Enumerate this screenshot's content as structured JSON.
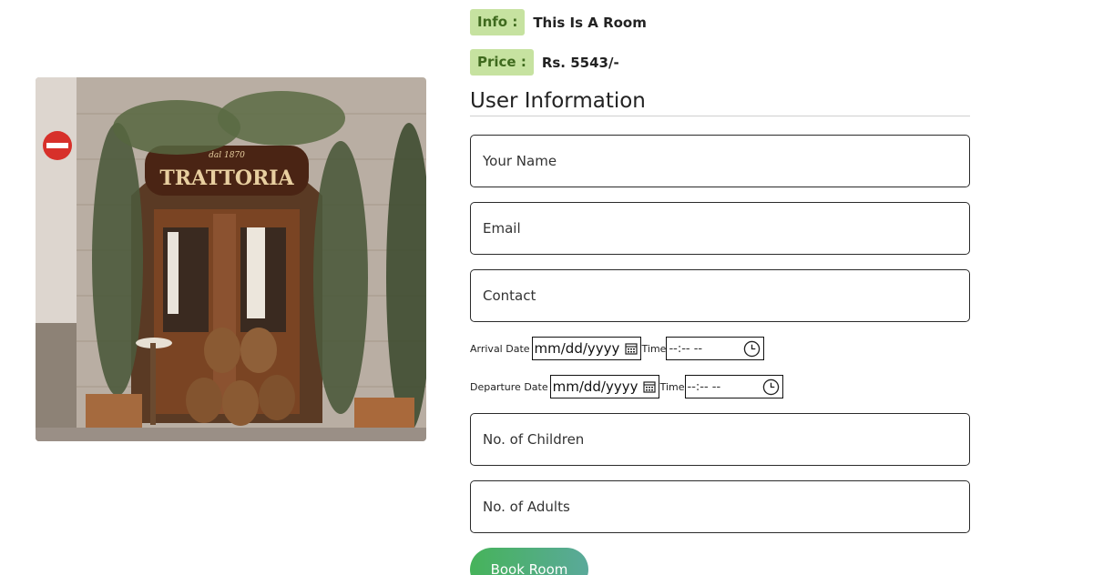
{
  "info": {
    "label": "Info :",
    "value": "This Is A Room"
  },
  "price": {
    "label": "Price :",
    "value": "Rs. 5543/-"
  },
  "section_title": "User Information",
  "form": {
    "name_placeholder": "Your Name",
    "email_placeholder": "Email",
    "contact_placeholder": "Contact",
    "arrival_label": "Arrival Date",
    "departure_label": "Departure Date",
    "time_label": "Time",
    "date_placeholder": "mm/dd/yyyy",
    "time_placeholder": "--:-- --",
    "children_placeholder": "No. of Children",
    "adults_placeholder": "No. of Adults",
    "submit_label": "Book Room"
  },
  "image": {
    "storefront_text": "TRATTORIA",
    "storefront_small_text": "dal 1870"
  },
  "colors": {
    "badge_bg": "#c6e2a0",
    "badge_text": "#3f6a1e",
    "button_start": "#46b35a",
    "button_end": "#5aa99a"
  }
}
